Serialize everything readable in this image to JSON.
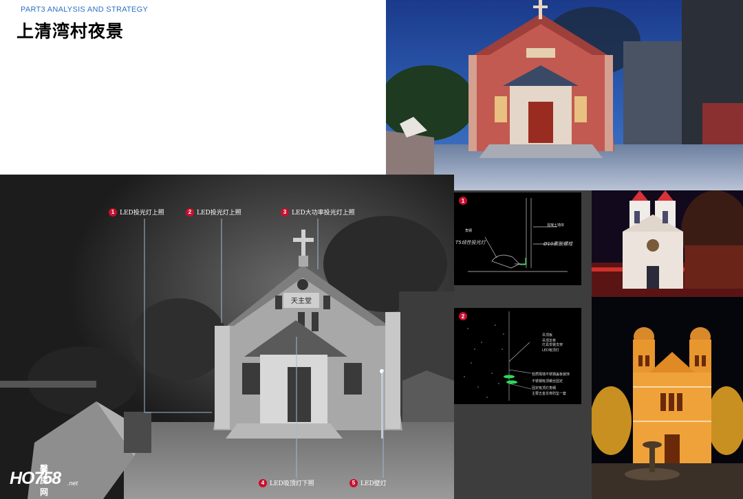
{
  "header": {
    "part_label": "PART3 ANALYSIS  AND  STRATEGY",
    "title": "上清湾村夜景"
  },
  "main_photo": {
    "callouts": [
      {
        "num": "1",
        "text": "LED投光灯上照"
      },
      {
        "num": "2",
        "text": "LED投光灯上照"
      },
      {
        "num": "3",
        "text": "LED大功率投光灯上照"
      },
      {
        "num": "4",
        "text": "LED吸顶灯下照"
      },
      {
        "num": "5",
        "text": "LED壁灯"
      }
    ],
    "church_sign": "天主堂"
  },
  "details": [
    {
      "num": "1",
      "labels": [
        "角钢",
        "T5线性投光灯",
        "混凝土墙体",
        "Ø10膨胀螺栓"
      ]
    },
    {
      "num": "2",
      "labels": [
        "吊顶板",
        "吊顶龙骨",
        "灯具安装支架",
        "LED吸顶灯",
        "轻质隔墙不锈钢盖板装饰",
        "不锈钢吸顶螺丝固定",
        "固定吸顶灯角钢",
        "主要五金龙骨防坠一套"
      ]
    }
  ],
  "watermark": {
    "brand": "HO758",
    "chinese": "馨房网",
    "suffix": ".net"
  },
  "colors": {
    "accent_blue": "#2a6fc4",
    "badge_red": "#c8102e"
  }
}
